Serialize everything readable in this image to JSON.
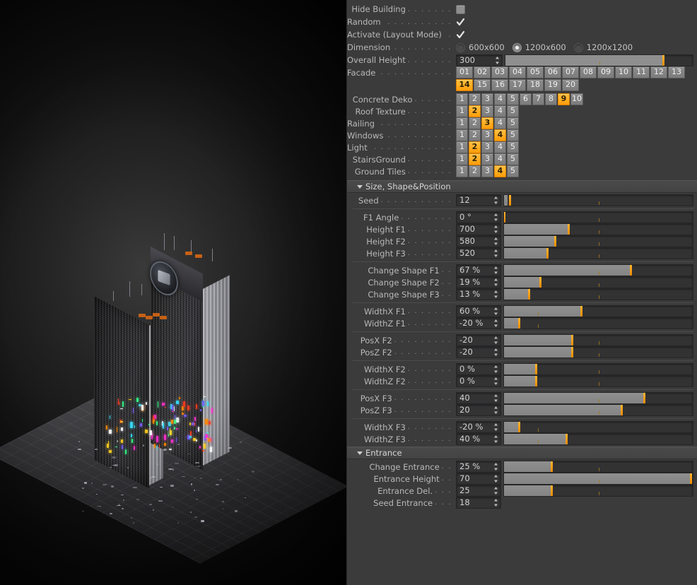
{
  "app": {
    "viewport_name": "3d-building-render"
  },
  "panel": {
    "toggles": [
      {
        "name": "hide-building",
        "label": "Hide Building",
        "type": "checkbox",
        "checked": false
      },
      {
        "name": "random",
        "label": "Random",
        "type": "checkbox",
        "checked": true
      },
      {
        "name": "activate-layout-mode",
        "label": "Activate (Layout Mode)",
        "type": "checkbox",
        "checked": true
      }
    ],
    "dimension": {
      "label": "Dimension",
      "options": [
        "600x600",
        "1200x600",
        "1200x1200"
      ],
      "selected": "1200x600"
    },
    "overall_height": {
      "label": "Overall Height",
      "value": "300",
      "fill_pct": 0,
      "knob_pct": 84,
      "tick_pct": 50
    },
    "facade": {
      "label": "Facade",
      "options": [
        "01",
        "02",
        "03",
        "04",
        "05",
        "06",
        "07",
        "08",
        "09",
        "10",
        "11",
        "12",
        "13",
        "14",
        "15",
        "16",
        "17",
        "18",
        "19",
        "20"
      ],
      "selected": "14"
    },
    "concrete_deko": {
      "label": "Concrete Deko",
      "options": [
        "1",
        "2",
        "3",
        "4",
        "5",
        "6",
        "7",
        "8",
        "9",
        "10"
      ],
      "selected": "9"
    },
    "roof_texture": {
      "label": "Roof Texture",
      "options": [
        "1",
        "2",
        "3",
        "4",
        "5"
      ],
      "selected": "2"
    },
    "railing": {
      "label": "Railing",
      "options": [
        "1",
        "2",
        "3",
        "4",
        "5"
      ],
      "selected": "3"
    },
    "windows": {
      "label": "Windows",
      "options": [
        "1",
        "2",
        "3",
        "4",
        "5"
      ],
      "selected": "4"
    },
    "light": {
      "label": "Light",
      "options": [
        "1",
        "2",
        "3",
        "4",
        "5"
      ],
      "selected": "2"
    },
    "stairs_ground": {
      "label": "StairsGround",
      "options": [
        "1",
        "2",
        "3",
        "4",
        "5"
      ],
      "selected": "2"
    },
    "ground_tiles": {
      "label": "Ground Tiles",
      "options": [
        "1",
        "2",
        "3",
        "4",
        "5"
      ],
      "selected": "4"
    },
    "section_size": {
      "title": "Size, Shape&Position",
      "groups": [
        {
          "rows": [
            {
              "name": "seed",
              "label": "Seed",
              "value": "12",
              "fill_pct": 2,
              "knob_pct": 3,
              "tick_pct": 50
            }
          ]
        },
        {
          "rows": [
            {
              "name": "f1-angle",
              "label": "F1 Angle",
              "value": "0 °",
              "fill_pct": 0,
              "knob_pct": 0,
              "tick_pct": 50
            },
            {
              "name": "height-f1",
              "label": "Height F1",
              "value": "700",
              "fill_pct": 34,
              "knob_pct": 34,
              "tick_pct": 50
            },
            {
              "name": "height-f2",
              "label": "Height F2",
              "value": "580",
              "fill_pct": 27,
              "knob_pct": 27,
              "tick_pct": 50
            },
            {
              "name": "height-f3",
              "label": "Height F3",
              "value": "520",
              "fill_pct": 23,
              "knob_pct": 23,
              "tick_pct": 50
            }
          ]
        },
        {
          "rows": [
            {
              "name": "change-shape-f1",
              "label": "Change Shape F1",
              "value": "67 %",
              "fill_pct": 67,
              "knob_pct": 67,
              "tick_pct": 50
            },
            {
              "name": "change-shape-f2",
              "label": "Change Shape F2",
              "value": "19 %",
              "fill_pct": 19,
              "knob_pct": 19,
              "tick_pct": 50
            },
            {
              "name": "change-shape-f3",
              "label": "Change Shape F3",
              "value": "13 %",
              "fill_pct": 13,
              "knob_pct": 13,
              "tick_pct": 50
            }
          ]
        },
        {
          "rows": [
            {
              "name": "widthx-f1",
              "label": "WidthX F1",
              "value": "60 %",
              "fill_pct": 41,
              "knob_pct": 41,
              "tick_pct": 18
            },
            {
              "name": "widthz-f1",
              "label": "WidthZ F1",
              "value": "-20 %",
              "fill_pct": 8,
              "knob_pct": 8,
              "tick_pct": 18
            }
          ]
        },
        {
          "rows": [
            {
              "name": "posx-f2",
              "label": "PosX F2",
              "value": "-20",
              "fill_pct": 36,
              "knob_pct": 36,
              "tick_pct": 50
            },
            {
              "name": "posz-f2",
              "label": "PosZ F2",
              "value": "-20",
              "fill_pct": 36,
              "knob_pct": 36,
              "tick_pct": 50
            }
          ]
        },
        {
          "rows": [
            {
              "name": "widthx-f2",
              "label": "WidthX F2",
              "value": "0 %",
              "fill_pct": 17,
              "knob_pct": 17,
              "tick_pct": 0
            },
            {
              "name": "widthz-f2",
              "label": "WidthZ F2",
              "value": "0 %",
              "fill_pct": 17,
              "knob_pct": 17,
              "tick_pct": 0
            }
          ]
        },
        {
          "rows": [
            {
              "name": "posx-f3",
              "label": "PosX F3",
              "value": "40",
              "fill_pct": 74,
              "knob_pct": 74,
              "tick_pct": 50
            },
            {
              "name": "posz-f3",
              "label": "PosZ F3",
              "value": "20",
              "fill_pct": 62,
              "knob_pct": 62,
              "tick_pct": 50
            }
          ]
        },
        {
          "rows": [
            {
              "name": "widthx-f3",
              "label": "WidthX F3",
              "value": "-20 %",
              "fill_pct": 8,
              "knob_pct": 8,
              "tick_pct": 18
            },
            {
              "name": "widthz-f3",
              "label": "WidthZ F3",
              "value": "40 %",
              "fill_pct": 33,
              "knob_pct": 33,
              "tick_pct": 18
            }
          ]
        }
      ]
    },
    "section_entrance": {
      "title": "Entrance",
      "rows": [
        {
          "name": "change-entrance",
          "label": "Change Entrance",
          "value": "25 %",
          "fill_pct": 25,
          "knob_pct": 25,
          "tick_pct": 50,
          "slider": true
        },
        {
          "name": "entrance-height",
          "label": "Entrance Height",
          "value": "70",
          "fill_pct": 99,
          "knob_pct": 99,
          "tick_pct": 50,
          "slider": true
        },
        {
          "name": "entrance-del",
          "label": "Entrance Del.",
          "value": "25",
          "fill_pct": 25,
          "knob_pct": 25,
          "tick_pct": 50,
          "slider": true
        },
        {
          "name": "seed-entrance",
          "label": "Seed Entrance",
          "value": "18",
          "slider": false
        }
      ]
    }
  }
}
